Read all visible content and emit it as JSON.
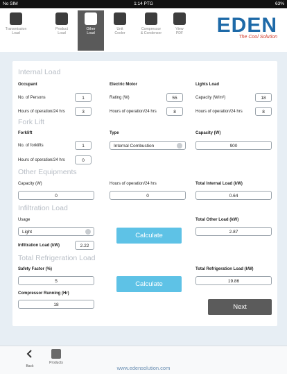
{
  "status": {
    "carrier": "No SIM",
    "time": "1:14 PTG",
    "battery": "63%"
  },
  "nav": [
    {
      "label": "Transmission\nLoad",
      "icon": "transmission-load-icon"
    },
    {
      "label": "Product\nLoad",
      "icon": "product-load-icon"
    },
    {
      "label": "Other\nLoad",
      "icon": "other-load-icon",
      "active": true
    },
    {
      "label": "Unit\nCooler",
      "icon": "unit-cooler-icon"
    },
    {
      "label": "Compressor\n& Condenser",
      "icon": "compressor-icon"
    },
    {
      "label": "View\nPDF",
      "icon": "pdf-icon"
    }
  ],
  "logo": {
    "word": "EDEN",
    "tagline": "The Cool Solution"
  },
  "internal_load": {
    "title": "Internal Load",
    "occupant": {
      "heading": "Occupant",
      "persons_label": "No. of Persons",
      "persons": "1",
      "hours_label": "Hours of operation/24 hrs",
      "hours": "3"
    },
    "motor": {
      "heading": "Electric Motor",
      "rating_label": "Rating (W)",
      "rating": "55",
      "hours_label": "Hours of operation/24 hrs",
      "hours": "8"
    },
    "lights": {
      "heading": "Lights Load",
      "capacity_label": "Capacity (W/m²)",
      "capacity": "18",
      "hours_label": "Hours of operation/24 hrs",
      "hours": "8"
    }
  },
  "fork_lift": {
    "title": "Fork Lift",
    "heading": "Forklift",
    "count_label": "No. of forklifts",
    "count": "1",
    "hours_label": "Hours of operation/24 hrs",
    "hours": "0",
    "type_label": "Type",
    "type": "Internal Combustion",
    "capacity_label": "Capacity (W)",
    "capacity": "900"
  },
  "other_equipments": {
    "title": "Other Equipments",
    "capacity_label": "Capacity (W)",
    "capacity": "0",
    "hours_label": "Hours of operation/24 hrs",
    "hours": "0",
    "total_internal_label": "Total Internal Load (kW)",
    "total_internal": "0.64"
  },
  "infiltration": {
    "title": "Infiltration Load",
    "usage_label": "Usage",
    "usage": "Light",
    "load_label": "Infiltration Load (kW)",
    "load": "2.22",
    "calculate": "Calculate",
    "total_other_label": "Total Other Load (kW)",
    "total_other": "2.87"
  },
  "total_refrigeration": {
    "title": "Total Refrigeration Load",
    "safety_label": "Safety Factor (%)",
    "safety": "5",
    "compressor_label": "Compressor Running (Hr)",
    "compressor": "18",
    "calculate": "Calculate",
    "total_label": "Total Refrigeration Load (kW)",
    "total": "19.86",
    "next": "Next"
  },
  "bottom": {
    "back": "Back",
    "products": "Products",
    "website": "www.edensolution.com"
  }
}
